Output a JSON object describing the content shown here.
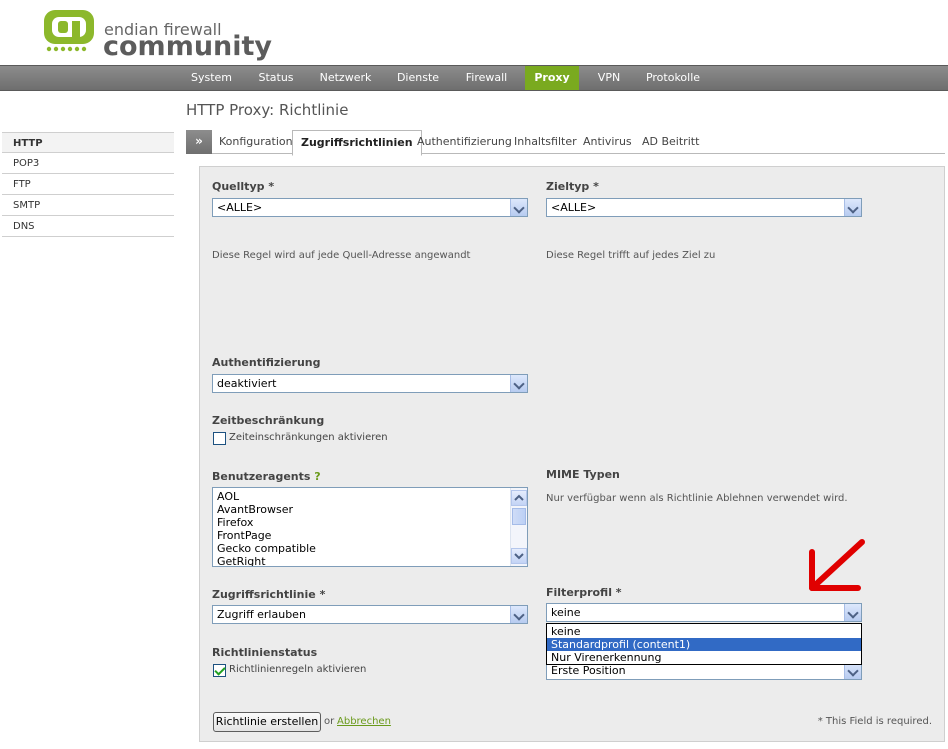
{
  "brand": {
    "line1": "endian firewall",
    "line2": "community"
  },
  "nav": {
    "items": [
      "System",
      "Status",
      "Netzwerk",
      "Dienste",
      "Firewall",
      "Proxy",
      "VPN",
      "Protokolle"
    ],
    "active": "Proxy"
  },
  "page_title": "HTTP Proxy: Richtlinie",
  "sidebar": {
    "items": [
      "HTTP",
      "POP3",
      "FTP",
      "SMTP",
      "DNS"
    ],
    "active": "HTTP"
  },
  "tabs": {
    "collapse_glyph": "»",
    "items": [
      "Konfiguration",
      "Zugriffsrichtlinien",
      "Authentifizierung",
      "Inhaltsfilter",
      "Antivirus",
      "AD Beitritt"
    ],
    "active": "Zugriffsrichtlinien"
  },
  "form": {
    "source_type": {
      "label": "Quelltyp *",
      "value": "<ALLE>",
      "help": "Diese Regel wird auf jede Quell-Adresse angewandt"
    },
    "target_type": {
      "label": "Zieltyp *",
      "value": "<ALLE>",
      "help": "Diese Regel trifft auf jedes Ziel zu"
    },
    "authentication": {
      "label": "Authentifizierung",
      "value": "deaktiviert"
    },
    "time_restriction": {
      "label": "Zeitbeschränkung",
      "checkbox_label": "Zeiteinschränkungen aktivieren",
      "checked": false
    },
    "user_agents": {
      "label": "Benutzeragents",
      "help_mark": "?",
      "options": [
        "AOL",
        "AvantBrowser",
        "Firefox",
        "FrontPage",
        "Gecko compatible",
        "GetRight"
      ]
    },
    "mime_types": {
      "label": "MIME Typen",
      "help": "Nur verfügbar wenn als Richtlinie Ablehnen verwendet wird."
    },
    "access_policy": {
      "label": "Zugriffsrichtlinie *",
      "value": "Zugriff erlauben"
    },
    "filter_profile": {
      "label": "Filterprofil *",
      "value": "keine",
      "options": [
        "keine",
        "Standardprofil (content1)",
        "Nur Virenerkennung"
      ],
      "highlighted": "Standardprofil (content1)"
    },
    "position": {
      "value": "Erste Position"
    },
    "policy_status": {
      "label": "Richtlinienstatus",
      "checkbox_label": "Richtlinienregeln aktivieren",
      "checked": true
    },
    "create_button": "Richtlinie erstellen",
    "or_text": "or",
    "cancel_link": "Abbrechen",
    "required_note": "* This Field is required."
  },
  "colors": {
    "accent_green": "#7aaa1f",
    "annotation_red": "#e00000",
    "highlight_blue": "#316ac5"
  }
}
